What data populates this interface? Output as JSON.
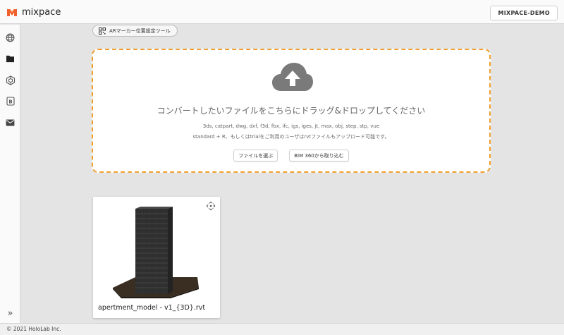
{
  "header": {
    "app_name": "mixpace",
    "account_label": "MIXPACE-DEMO",
    "brand_color": "#f0612f"
  },
  "sidebar": {
    "items": [
      {
        "icon": "globe-icon"
      },
      {
        "icon": "folder-icon"
      },
      {
        "icon": "cube-network-icon"
      },
      {
        "icon": "b-badge-icon"
      },
      {
        "icon": "mail-icon"
      }
    ],
    "collapse_label": "»"
  },
  "ar_tool": {
    "label": "ARマーカー位置設定ツール",
    "icon": "qr-code-icon"
  },
  "dropzone": {
    "title": "コンバートしたいファイルをこちらにドラッグ&ドロップしてください",
    "formats": "3ds, catpart, dwg, dxf, f3d, fbx, ifc, igs, iges, jt, max, obj, step, stp, vue",
    "rvt_note": "standard + R、もしくはtrialをご利用のユーザはrvtファイルもアップロード可能です。",
    "select_file_label": "ファイルを選ぶ",
    "bim360_label": "BIM 360から取り込む",
    "border_color": "#f0a030"
  },
  "models": [
    {
      "name": "apertment_model - v1_{3D}.rvt"
    }
  ],
  "footer": {
    "copyright": "© 2021 HoloLab Inc."
  }
}
